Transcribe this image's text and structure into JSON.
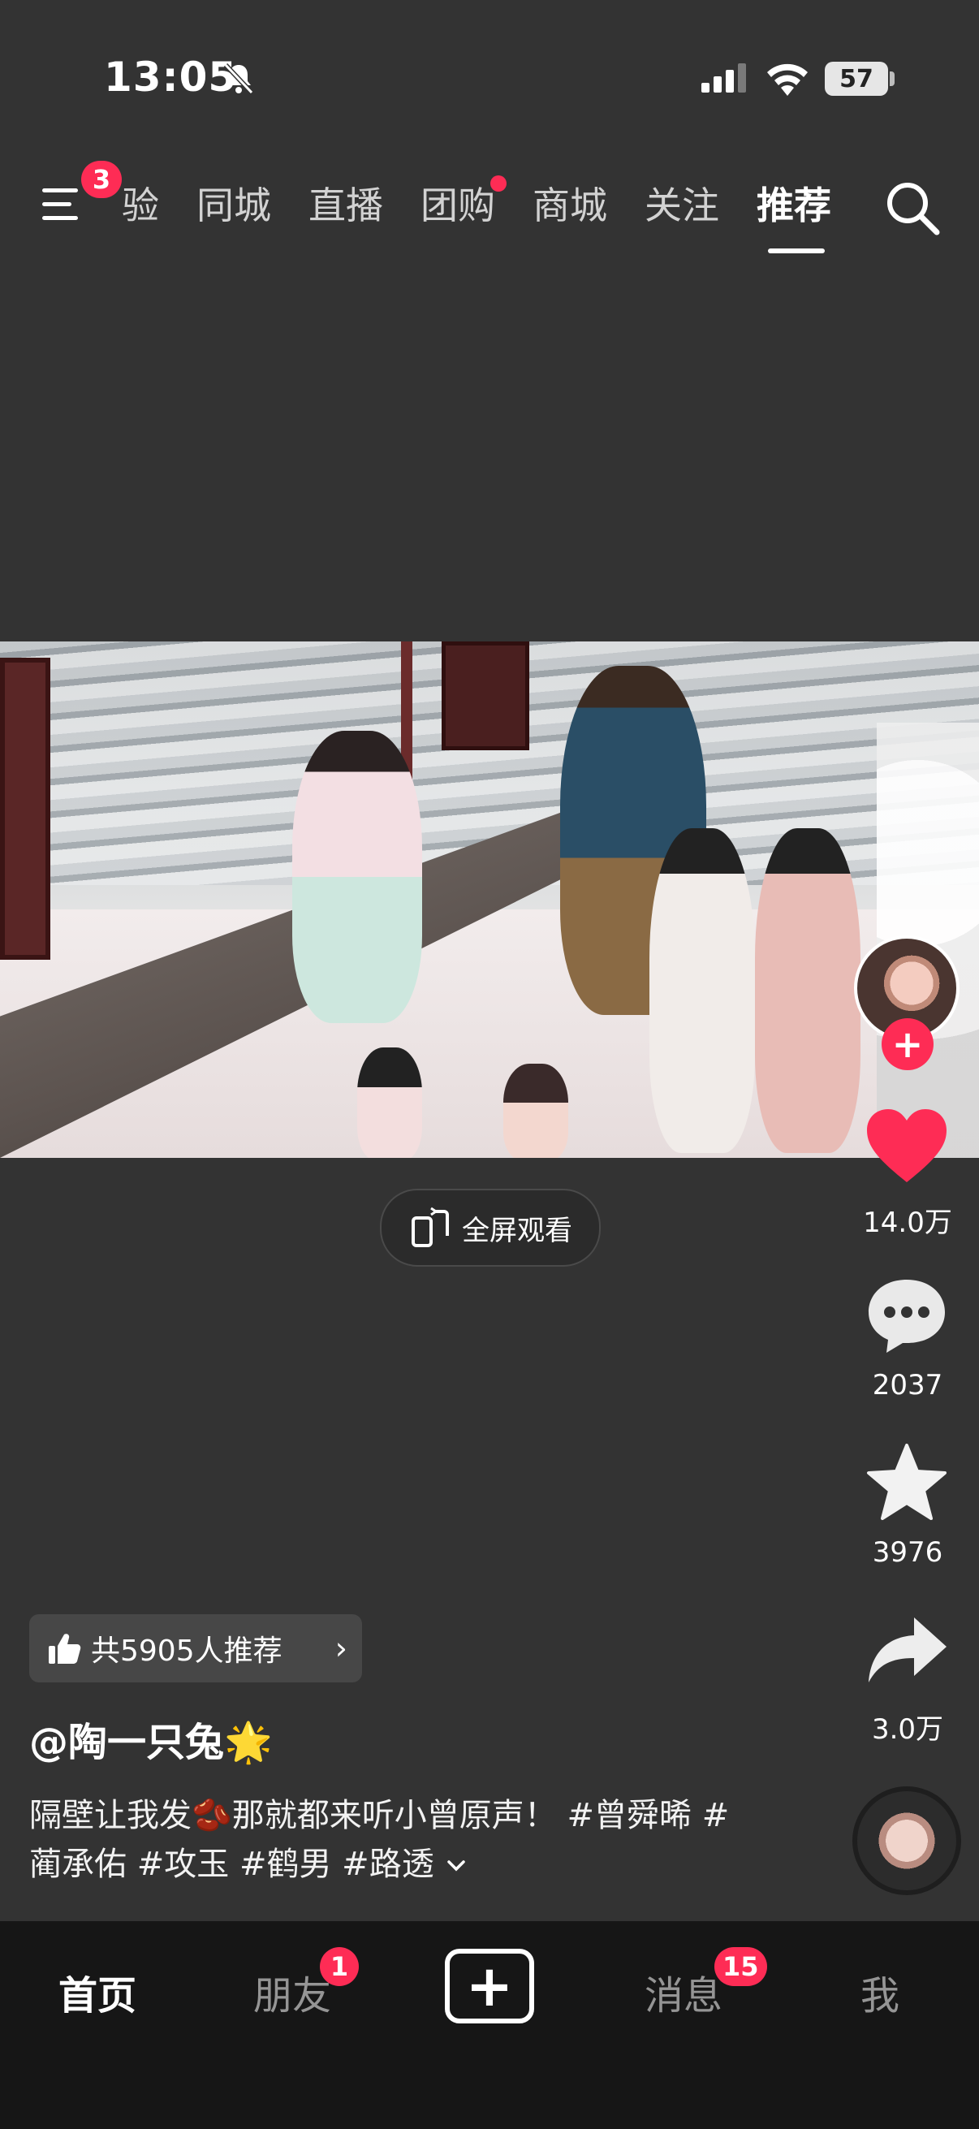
{
  "status_bar": {
    "time": "13:05",
    "battery": "57",
    "icons": [
      "bell-off-icon",
      "signal-icon",
      "wifi-icon",
      "battery-icon"
    ]
  },
  "top_nav": {
    "menu_badge": "3",
    "tabs": [
      {
        "label": "验",
        "active": false,
        "dot": false
      },
      {
        "label": "同城",
        "active": false,
        "dot": false
      },
      {
        "label": "直播",
        "active": false,
        "dot": false
      },
      {
        "label": "团购",
        "active": false,
        "dot": true
      },
      {
        "label": "商城",
        "active": false,
        "dot": false
      },
      {
        "label": "关注",
        "active": false,
        "dot": false
      },
      {
        "label": "推荐",
        "active": true,
        "dot": false
      }
    ]
  },
  "video": {
    "fullscreen_label": "全屏观看"
  },
  "actions": {
    "like_count": "14.0万",
    "comment_count": "2037",
    "favorite_count": "3976",
    "share_count": "3.0万"
  },
  "post": {
    "recommend_text": "共5905人推荐",
    "author": "@陶一只兔🌟",
    "caption": "隔壁让我发🫘那就都来听小曾原声！ #曾舜晞 #蔺承佑 #攻玉 #鹤男 #路透"
  },
  "bottom_nav": {
    "home": "首页",
    "friends": "朋友",
    "friends_badge": "1",
    "create": "+",
    "messages": "消息",
    "messages_badge": "15",
    "me": "我"
  },
  "colors": {
    "background": "#333333",
    "accent": "#fe2c55",
    "bottom_bar": "#161616"
  }
}
